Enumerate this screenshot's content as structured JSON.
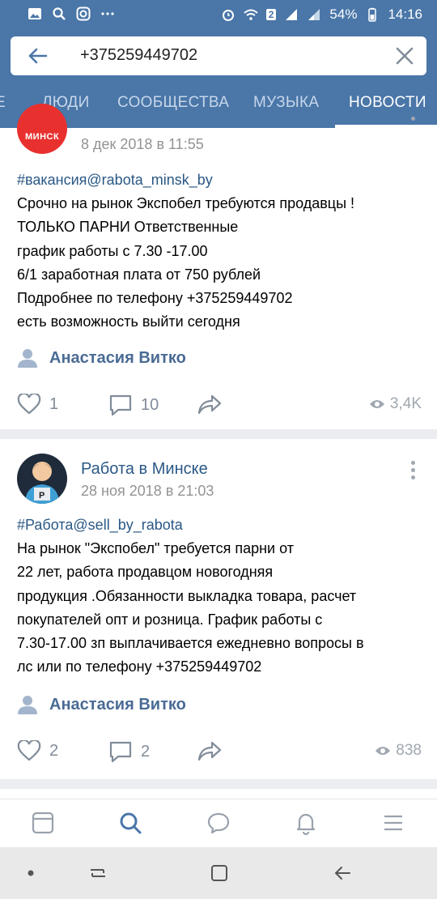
{
  "status_bar": {
    "battery": "54%",
    "time": "14:16",
    "sim_badge": "2"
  },
  "search": {
    "query": "+375259449702"
  },
  "tabs": [
    {
      "label": "Е"
    },
    {
      "label": "ЛЮДИ"
    },
    {
      "label": "СООБЩЕСТВА"
    },
    {
      "label": "МУЗЫКА"
    },
    {
      "label": "НОВОСТИ",
      "active": true
    }
  ],
  "posts": [
    {
      "avatar_text": "МИНСК",
      "date": "8 дек 2018 в 11:55",
      "hashtag": "#вакансия@rabota_minsk_by",
      "lines": [
        "Срочно на рынок Экспобел требуются продавцы !",
        "ТОЛЬКО ПАРНИ Ответственные",
        "график работы с 7.30 -17.00",
        "6/1 заработная плата от 750 рублей",
        "Подробнее по телефону +375259449702",
        "есть возможность выйти сегодня"
      ],
      "signer": "Анастасия Витко",
      "likes": "1",
      "comments": "10",
      "views": "3,4K"
    },
    {
      "author": "Работа в Минске",
      "avatar_text": "P",
      "date": "28 ноя 2018 в 21:03",
      "hashtag": "#Работа@sell_by_rabota",
      "lines": [
        "На рынок \"Экспобел\" требуется парни от",
        "22 лет, работа продавцом новогодняя",
        "продукция .Обязанности выкладка товара, расчет",
        "покупателей опт и розница. График работы с",
        "7.30-17.00 зп выплачивается ежедневно вопросы в",
        "лс или по телефону +375259449702"
      ],
      "signer": "Анастасия Витко",
      "likes": "2",
      "comments": "2",
      "views": "838"
    }
  ],
  "colors": {
    "brand": "#4a76a8",
    "link": "#2a5885",
    "muted": "#939393",
    "icon": "#4a76a8"
  }
}
